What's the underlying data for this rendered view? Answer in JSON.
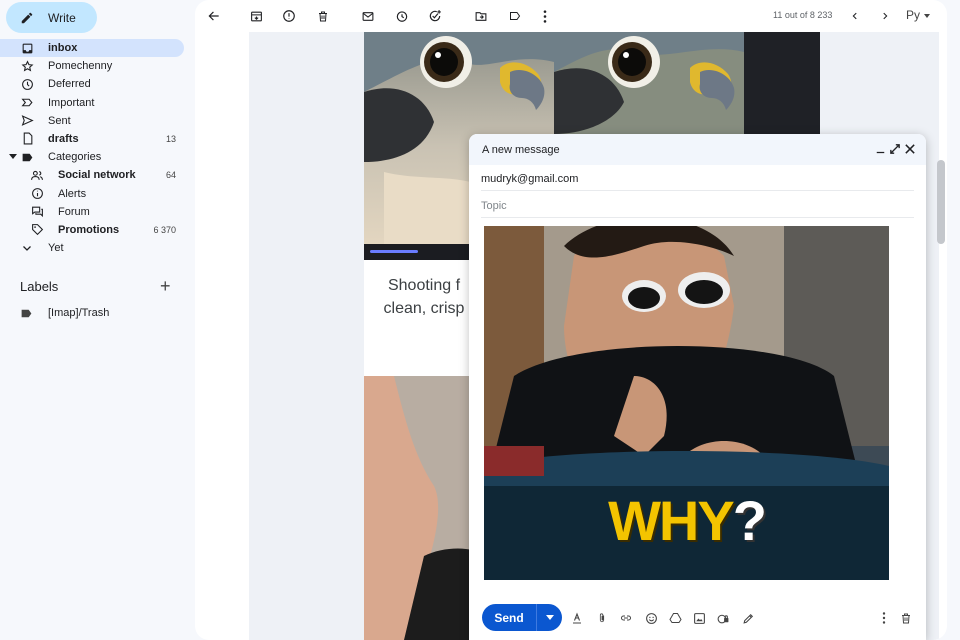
{
  "sidebar": {
    "write_label": "Write",
    "items": [
      {
        "label": "inbox",
        "count": "",
        "icon": "inbox-icon",
        "active": true
      },
      {
        "label": "Pomechenny",
        "count": "",
        "icon": "star-icon"
      },
      {
        "label": "Deferred",
        "count": "",
        "icon": "clock-icon"
      },
      {
        "label": "Important",
        "count": "",
        "icon": "important-icon"
      },
      {
        "label": "Sent",
        "count": "",
        "icon": "send-icon"
      },
      {
        "label": "drafts",
        "count": "13",
        "icon": "draft-icon",
        "bold": true
      },
      {
        "label": "Categories",
        "count": "",
        "icon": "label-icon",
        "expanded": true
      },
      {
        "label": "Social network",
        "count": "64",
        "icon": "people-icon",
        "bold": true,
        "sub": true
      },
      {
        "label": "Alerts",
        "count": "",
        "icon": "info-icon",
        "sub": true
      },
      {
        "label": "Forum",
        "count": "",
        "icon": "forum-icon",
        "sub": true
      },
      {
        "label": "Promotions",
        "count": "6 370",
        "icon": "tag-icon",
        "bold": true,
        "sub": true
      },
      {
        "label": "Yet",
        "count": "",
        "icon": "chevron-down-icon"
      }
    ],
    "labels_title": "Labels",
    "labels": [
      {
        "label": "[Imap]/Trash",
        "icon": "label-icon"
      }
    ]
  },
  "toolbar": {
    "pager_text": "11 out of 8 233",
    "lang": "Py"
  },
  "email": {
    "headline_line1": "Shooting f",
    "headline_line2": "clean, crisp"
  },
  "compose": {
    "title": "A new message",
    "to": "mudryk@gmail.com",
    "subject_placeholder": "Topic",
    "gif_caption_main": "WHY",
    "gif_caption_q": "?",
    "send_label": "Send"
  },
  "colors": {
    "accent": "#0b57d0",
    "active_nav": "#d3e3fd",
    "write_button": "#c2e7ff",
    "caption_yellow": "#f4c400"
  }
}
